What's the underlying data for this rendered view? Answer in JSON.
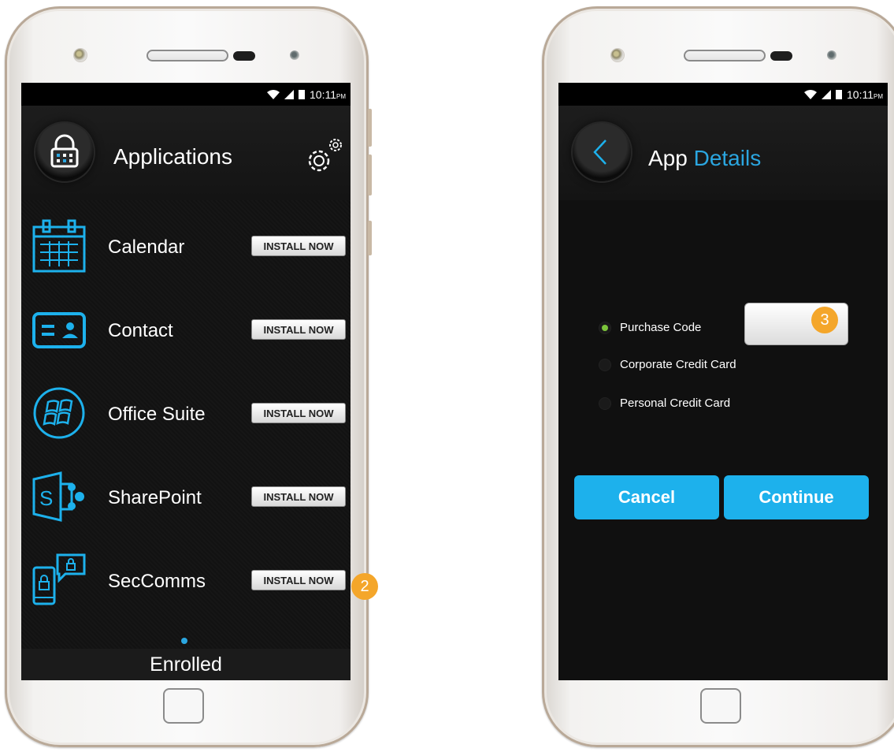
{
  "colors": {
    "accent": "#1db1ec",
    "badge": "#f4a62a",
    "radio_selected": "#7cc43b"
  },
  "left_phone": {
    "status": {
      "time": "10:11",
      "ampm": "PM"
    },
    "header": {
      "title": "Applications",
      "lock_icon": "lock-icon",
      "settings_icon": "gears-icon"
    },
    "apps": [
      {
        "name": "Calendar",
        "icon": "calendar-icon",
        "button": "INSTALL NOW"
      },
      {
        "name": "Contact",
        "icon": "contact-card-icon",
        "button": "INSTALL NOW"
      },
      {
        "name": "Office Suite",
        "icon": "office-icon",
        "button": "INSTALL NOW"
      },
      {
        "name": "SharePoint",
        "icon": "sharepoint-icon",
        "button": "INSTALL NOW"
      },
      {
        "name": "SecComms",
        "icon": "secure-messaging-icon",
        "button": "INSTALL NOW"
      }
    ],
    "footer": {
      "label": "Enrolled"
    },
    "badge": "2"
  },
  "right_phone": {
    "status": {
      "time": "10:11",
      "ampm": "PM"
    },
    "header": {
      "title_part1": "App",
      "title_part2": "Details",
      "back_icon": "chevron-left-icon"
    },
    "payment_options": [
      {
        "label": "Purchase Code",
        "selected": true
      },
      {
        "label": "Corporate Credit Card",
        "selected": false
      },
      {
        "label": "Personal Credit Card",
        "selected": false
      }
    ],
    "purchase_code_value": "",
    "badge": "3",
    "buttons": {
      "cancel": "Cancel",
      "continue": "Continue"
    }
  }
}
